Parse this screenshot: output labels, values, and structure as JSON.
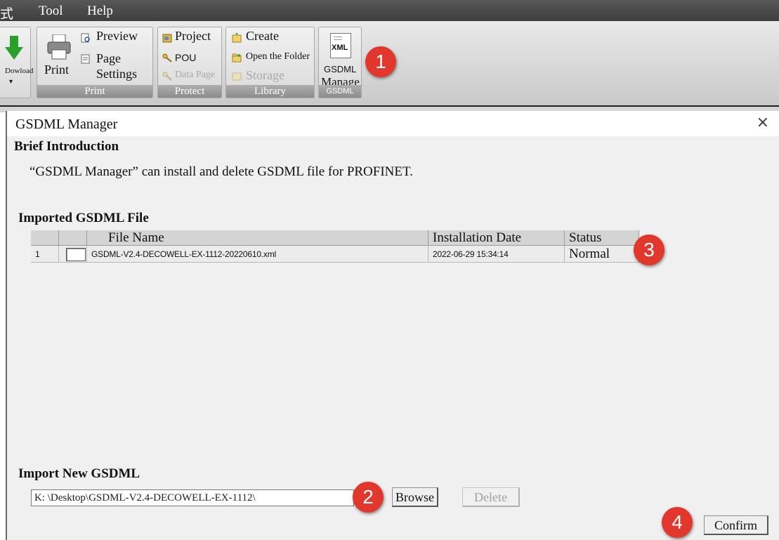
{
  "menu": {
    "items": [
      {
        "label": "式"
      },
      {
        "label": "Tool"
      },
      {
        "label": "Help"
      }
    ]
  },
  "ribbon": {
    "download_label": "Dowload",
    "print_group": {
      "label": "Print",
      "print_label": "Print",
      "preview_label": "Preview",
      "page_label": "Page",
      "settings_label": "Settings"
    },
    "protect_group": {
      "label": "Protect",
      "project_label": "Project",
      "pou_label": "POU",
      "data_page_label": "Data Page"
    },
    "library_group": {
      "label": "Library",
      "create_label": "Create",
      "open_folder_label": "Open the Folder",
      "storage_label": "Storage"
    },
    "gsdml_group": {
      "label": "GSDML",
      "icon_text": "XML",
      "manage_line1": "GSDML",
      "manage_line2": "Manage"
    }
  },
  "badges": {
    "one": "1",
    "two": "2",
    "three": "3",
    "four": "4"
  },
  "dialog": {
    "title": "GSDML Manager",
    "close_glyph": "×",
    "brief_heading": "Brief Introduction",
    "brief_text": "“GSDML Manager” can install and delete GSDML file for PROFINET.",
    "imported_heading": "Imported GSDML File",
    "table": {
      "columns": [
        "",
        "",
        "File Name",
        "Installation Date",
        "Status"
      ],
      "rows": [
        {
          "index": "1",
          "file_name": "GSDML-V2.4-DECOWELL-EX-1112-20220610.xml",
          "installation_date": "2022-06-29 15:34:14",
          "status": "Normal"
        }
      ]
    },
    "import_heading": "Import New GSDML",
    "path_value": "K: \\Desktop\\GSDML-V2.4-DECOWELL-EX-1112\\",
    "browse_label": "Browse",
    "delete_label": "Delete",
    "confirm_label": "Confirm"
  },
  "colors": {
    "badge": "#e2372c",
    "menubar": "#4a4a4a",
    "group_label": "#9c9c9c"
  }
}
